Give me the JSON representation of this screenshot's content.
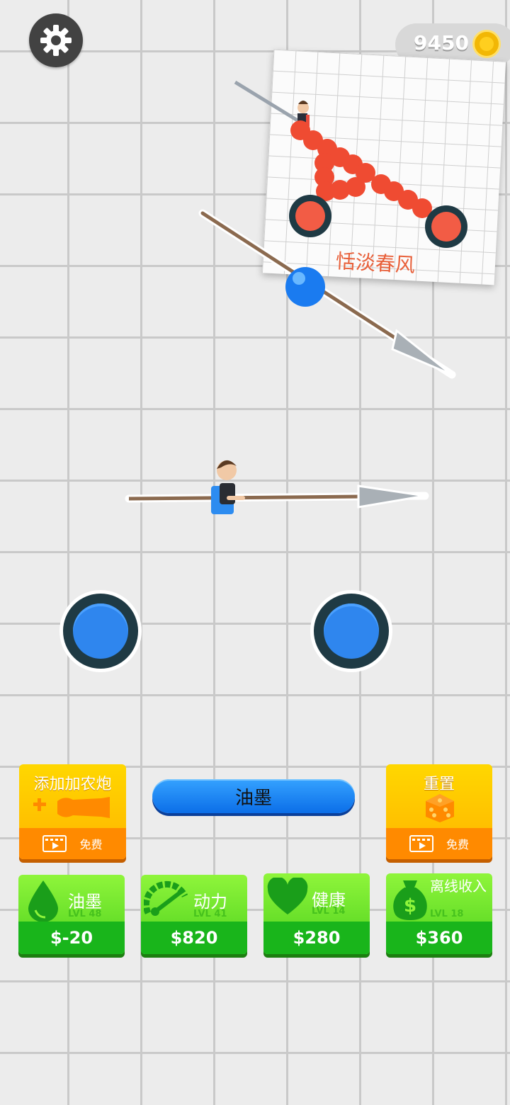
{
  "header": {
    "coin_count": "9450"
  },
  "drawing_card": {
    "watermark": "恬淡春风"
  },
  "center_button": {
    "label": "油墨"
  },
  "add_cannon": {
    "title": "添加加农炮",
    "free_label": "免费"
  },
  "reset": {
    "title": "重置",
    "free_label": "免费"
  },
  "upgrades": [
    {
      "title": "油墨",
      "level": "LVL 48",
      "price": "$-20",
      "icon": "ink-drop-icon"
    },
    {
      "title": "动力",
      "level": "LVL 41",
      "price": "$820",
      "icon": "speedometer-icon"
    },
    {
      "title": "健康",
      "level": "LVL 14",
      "price": "$280",
      "icon": "heart-icon"
    },
    {
      "title": "离线收入",
      "level": "LVL 18",
      "price": "$360",
      "icon": "money-bag-icon"
    }
  ],
  "colors": {
    "yellow": "#ffc400",
    "orange": "#ff8a00",
    "green": "#4dd11d",
    "blue": "#1f86f0"
  }
}
